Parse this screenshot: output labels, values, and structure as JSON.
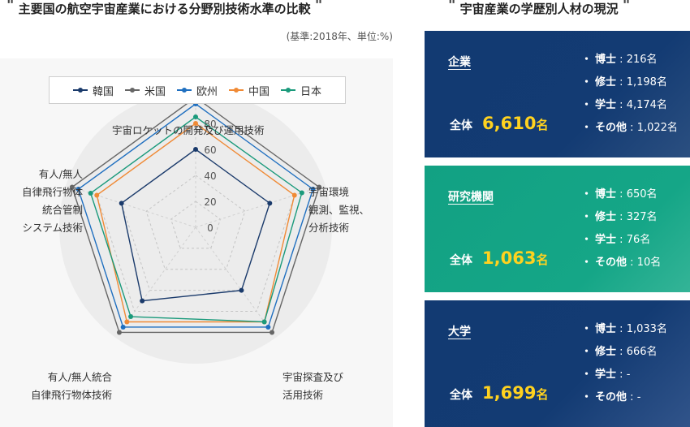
{
  "left_heading": "主要国の航空宇宙産業における分野別技術水準の比較",
  "right_heading": "宇宙産業の学歴別人材の現況",
  "note": "(基準:2018年、単位:%)",
  "quote_mark": "\"",
  "colors": {
    "korea": "#1a3a6b",
    "usa": "#666666",
    "europe": "#1f6fc0",
    "china": "#f08a35",
    "japan": "#1a9a7b",
    "navy": "#133b73",
    "green": "#14a385",
    "gold": "#ffd21f"
  },
  "chart_data": {
    "type": "radar",
    "axes": [
      "宇宙ロケットの開発及び運用技術",
      "宇宙環境観測、監視、分析技術",
      "宇宙探査及び活用技術",
      "有人/無人統合自律飛行物体技術",
      "有人/無人自律飛行物体統合管制システム技術"
    ],
    "axis_label_lines": [
      [
        "宇宙ロケットの開発及び運用技術"
      ],
      [
        "宇宙環境",
        "観測、監視、",
        "分析技術"
      ],
      [
        "宇宙探査及び",
        "活用技術"
      ],
      [
        "有人/無人統合",
        "自律飛行物体技術"
      ],
      [
        "有人/無人",
        "自律飛行物体",
        "統合管制",
        "システム技術"
      ]
    ],
    "r_ticks": [
      "0",
      "20",
      "40",
      "60",
      "80",
      "100"
    ],
    "rlim": [
      0,
      100
    ],
    "grid": true,
    "legend_position": "top",
    "series": [
      {
        "name": "韓国",
        "key": "korea",
        "values": [
          60,
          60,
          60,
          70,
          60
        ]
      },
      {
        "name": "米国",
        "key": "usa",
        "values": [
          100,
          100,
          100,
          100,
          100
        ]
      },
      {
        "name": "欧州",
        "key": "europe",
        "values": [
          95,
          95,
          95,
          95,
          95
        ]
      },
      {
        "name": "中国",
        "key": "china",
        "values": [
          80,
          80,
          90,
          90,
          80
        ]
      },
      {
        "name": "日本",
        "key": "japan",
        "values": [
          85,
          86,
          90,
          85,
          85
        ]
      }
    ]
  },
  "cards": [
    {
      "title": "企業",
      "total_label": "全体",
      "total_value": "6,610",
      "unit": "名",
      "items": [
        {
          "k": "博士",
          "v": "216名"
        },
        {
          "k": "修士",
          "v": "1,198名"
        },
        {
          "k": "学士",
          "v": "4,174名"
        },
        {
          "k": "その他",
          "v": "1,022名"
        }
      ]
    },
    {
      "title": "研究機関",
      "total_label": "全体",
      "total_value": "1,063",
      "unit": "名",
      "items": [
        {
          "k": "博士",
          "v": "650名"
        },
        {
          "k": "修士",
          "v": "327名"
        },
        {
          "k": "学士",
          "v": "76名"
        },
        {
          "k": "その他",
          "v": "10名"
        }
      ]
    },
    {
      "title": "大学",
      "total_label": "全体",
      "total_value": "1,699",
      "unit": "名",
      "items": [
        {
          "k": "博士",
          "v": "1,033名"
        },
        {
          "k": "修士",
          "v": "666名"
        },
        {
          "k": "学士",
          "v": "-"
        },
        {
          "k": "その他",
          "v": "-"
        }
      ]
    }
  ]
}
